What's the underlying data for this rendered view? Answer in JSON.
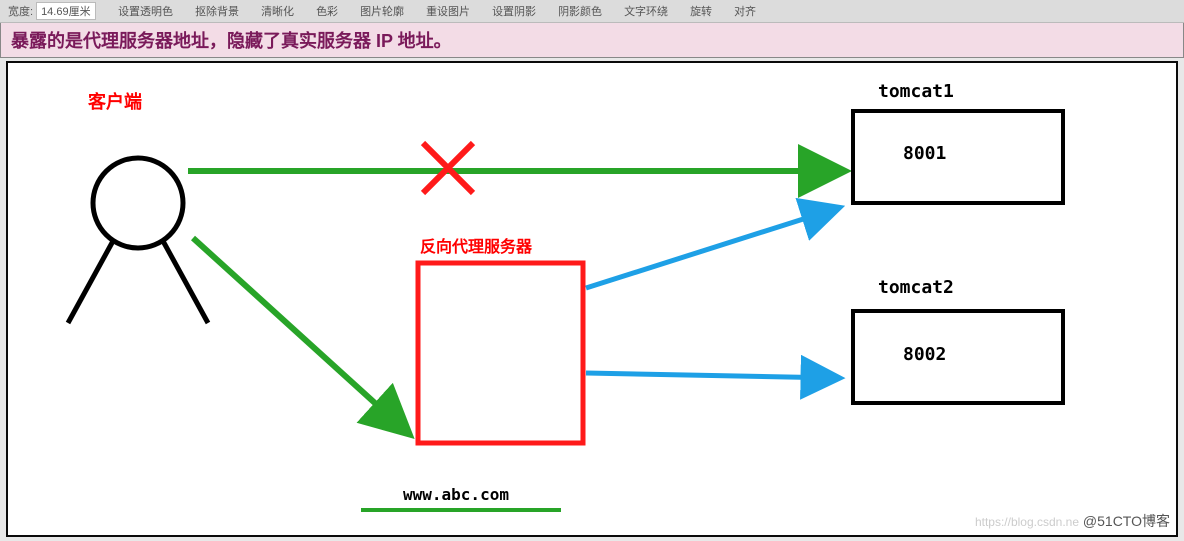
{
  "toolbar": {
    "width_label": "宽度:",
    "width_value": "14.69厘米",
    "items": [
      "设置透明色",
      "抠除背景",
      "清晰化",
      "色彩",
      "图片轮廓",
      "重设图片",
      "设置阴影",
      "阴影颜色",
      "文字环绕",
      "旋转",
      "对齐"
    ]
  },
  "headline": "暴露的是代理服务器地址，隐藏了真实服务器 IP 地址。",
  "diagram": {
    "client_label": "客户端",
    "proxy_label": "反向代理服务器",
    "tomcat1_label": "tomcat1",
    "tomcat2_label": "tomcat2",
    "port1": "8001",
    "port2": "8002",
    "domain": "www.abc.com"
  },
  "colors": {
    "green": "#28a428",
    "red": "#ff1a1a",
    "blue": "#1ea0e6",
    "black": "#000000"
  },
  "watermark": {
    "faint": "https://blog.csdn.ne",
    "text": "@51CTO博客"
  }
}
